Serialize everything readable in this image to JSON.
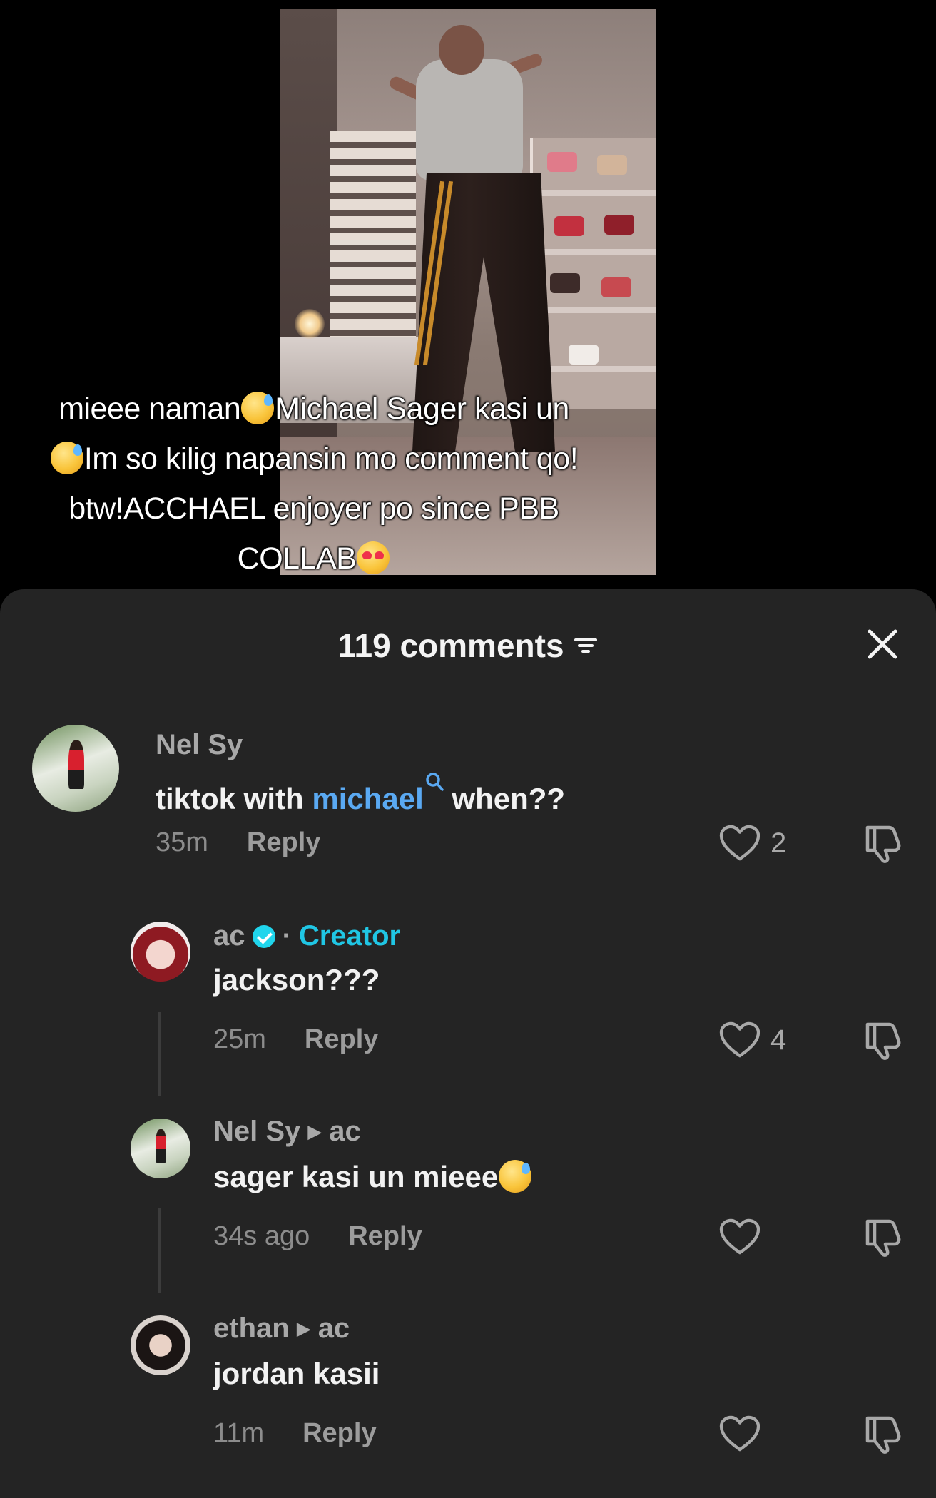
{
  "video": {
    "caption_lines": [
      {
        "before": "mieee naman",
        "after": "Michael Sager kasi un"
      },
      {
        "before": "",
        "after": "Im so kilig napansin mo comment qo!"
      },
      {
        "before": "",
        "after": "btw!ACCHAEL enjoyer po since PBB"
      },
      {
        "before": "COLLAB",
        "after": ""
      }
    ]
  },
  "sheet": {
    "count_label": "119 comments",
    "icons": {
      "sort": "sort-icon",
      "close": "close-icon"
    }
  },
  "comments": [
    {
      "author": "Nel Sy",
      "text_before": "tiktok with ",
      "mention": "michael",
      "text_after": " when??",
      "time": "35m",
      "reply_label": "Reply",
      "likes": "2"
    }
  ],
  "replies": [
    {
      "author": "ac",
      "verified": true,
      "separator": "·",
      "role": "Creator",
      "text": "jackson???",
      "time": "25m",
      "reply_label": "Reply",
      "likes": "4"
    },
    {
      "author": "Nel Sy",
      "reply_to": "ac",
      "text": "sager kasi un mieee",
      "time": "34s ago",
      "reply_label": "Reply",
      "likes": ""
    },
    {
      "author": "ethan",
      "reply_to": "ac",
      "text": "jordan kasii",
      "time": "11m",
      "reply_label": "Reply",
      "likes": ""
    }
  ],
  "colors": {
    "sheet_bg": "#242424",
    "creator_accent": "#20c6e4",
    "mention": "#5aa9f2"
  }
}
